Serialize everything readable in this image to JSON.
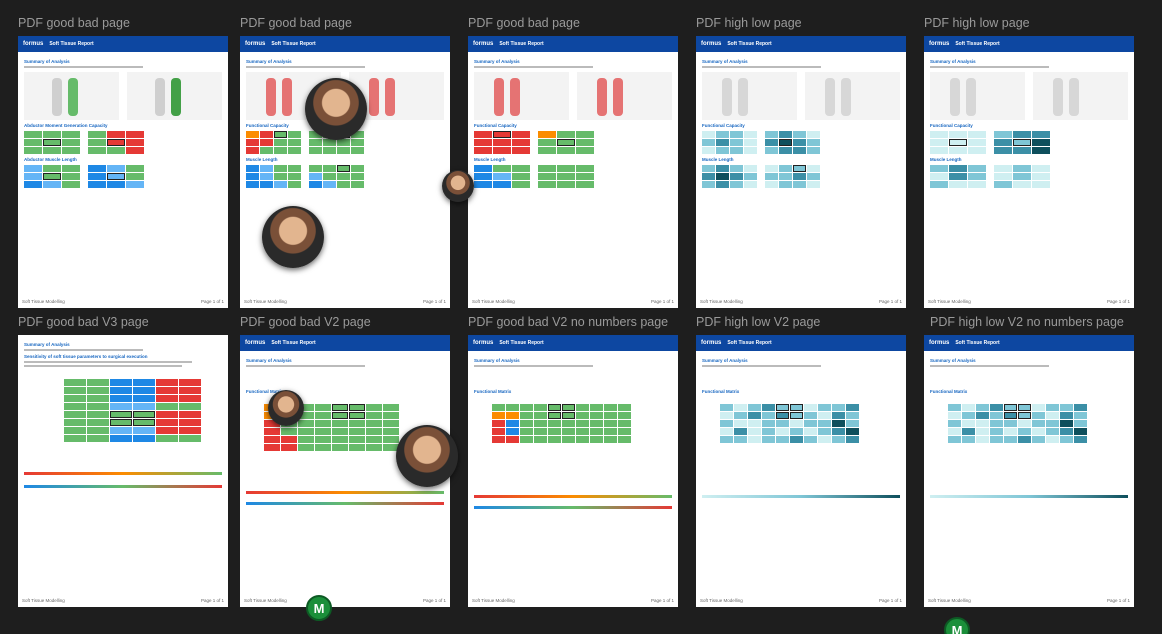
{
  "page": {
    "header_logo": "formus",
    "header_title": "Soft Tissue Report",
    "footer_left": "Soft Tissue Modelling",
    "footer_right": "Page 1 of 1"
  },
  "frames": [
    {
      "label": "PDF good bad page"
    },
    {
      "label": "PDF good bad page"
    },
    {
      "label": "PDF good bad page"
    },
    {
      "label": "PDF high low page"
    },
    {
      "label": "PDF high low page"
    },
    {
      "label": "PDF good bad V3 page"
    },
    {
      "label": "PDF good bad V2 page"
    },
    {
      "label": "PDF good bad V2 no numbers page"
    },
    {
      "label": "PDF high low V2 page"
    },
    {
      "label": "PDF high low V2 no numbers page"
    }
  ],
  "sections": {
    "summary": "Summary of Analysis",
    "functional": "Functional Capacity",
    "muscle": "Muscle Length",
    "matrix": "Functional Matrix",
    "abductor_moment": "Abductor Moment Generation Capacity",
    "abductor_length": "Abductor Muscle Length",
    "sensitivity": "Sensitivity of soft tissue parameters to surgical execution"
  },
  "cursor_badge": "M",
  "colors": {
    "good": "#66bb6a",
    "bad": "#e53935",
    "mid": "#fb8c00",
    "blue": "#1e88e5",
    "header": "#0d47a1"
  }
}
